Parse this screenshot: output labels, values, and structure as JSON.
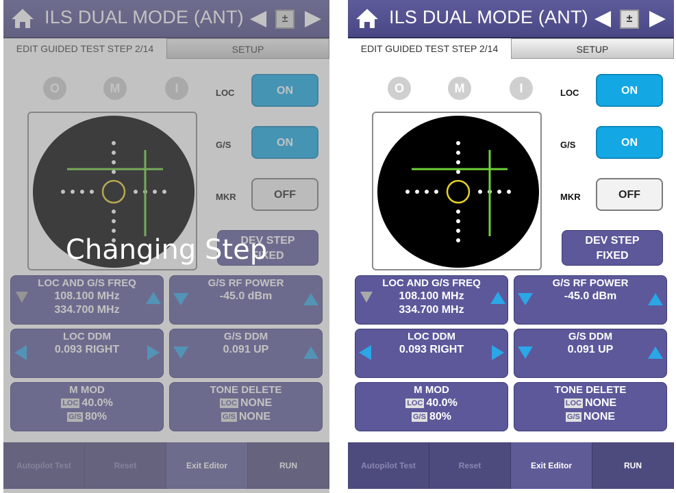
{
  "app": {
    "title": "ILS DUAL MODE (ANT)",
    "calc_icon_glyph": "±"
  },
  "tabs": {
    "edit_label": "EDIT GUIDED TEST STEP 2/14",
    "setup_label": "SETUP"
  },
  "markers": [
    "O",
    "M",
    "I"
  ],
  "switches": {
    "loc_label": "LOC",
    "loc_state": "ON",
    "gs_label": "G/S",
    "gs_state": "ON",
    "mkr_label": "MKR",
    "mkr_state": "OFF"
  },
  "dev_step": {
    "line1": "DEV STEP",
    "line2": "FIXED"
  },
  "panels": {
    "freq": {
      "title": "LOC AND G/S FREQ",
      "loc_freq": "108.100 MHz",
      "gs_freq": "334.700 MHz"
    },
    "rf_power": {
      "title": "G/S RF POWER",
      "value": "-45.0 dBm"
    },
    "loc_ddm": {
      "title": "LOC DDM",
      "value": "0.093 RIGHT"
    },
    "gs_ddm": {
      "title": "G/S DDM",
      "value": "0.091 UP"
    },
    "m_mod": {
      "title": "M MOD",
      "loc_badge": "LOC",
      "loc_value": "40.0%",
      "gs_badge": "G/S",
      "gs_value": "80%"
    },
    "tone_delete": {
      "title": "TONE DELETE",
      "loc_badge": "LOC",
      "loc_value": "NONE",
      "gs_badge": "G/S",
      "gs_value": "NONE"
    }
  },
  "bottom": {
    "autopilot": "Autopilot Test",
    "reset": "Reset",
    "exit_editor": "Exit Editor",
    "run": "RUN"
  },
  "overlay_text": "Changing Step",
  "colors": {
    "title_bar": "#4f4c8a",
    "panel": "#5c589a",
    "switch_on": "#13a8e4",
    "crosshair": "#6fd13a",
    "center_ring": "#e8d02a"
  }
}
